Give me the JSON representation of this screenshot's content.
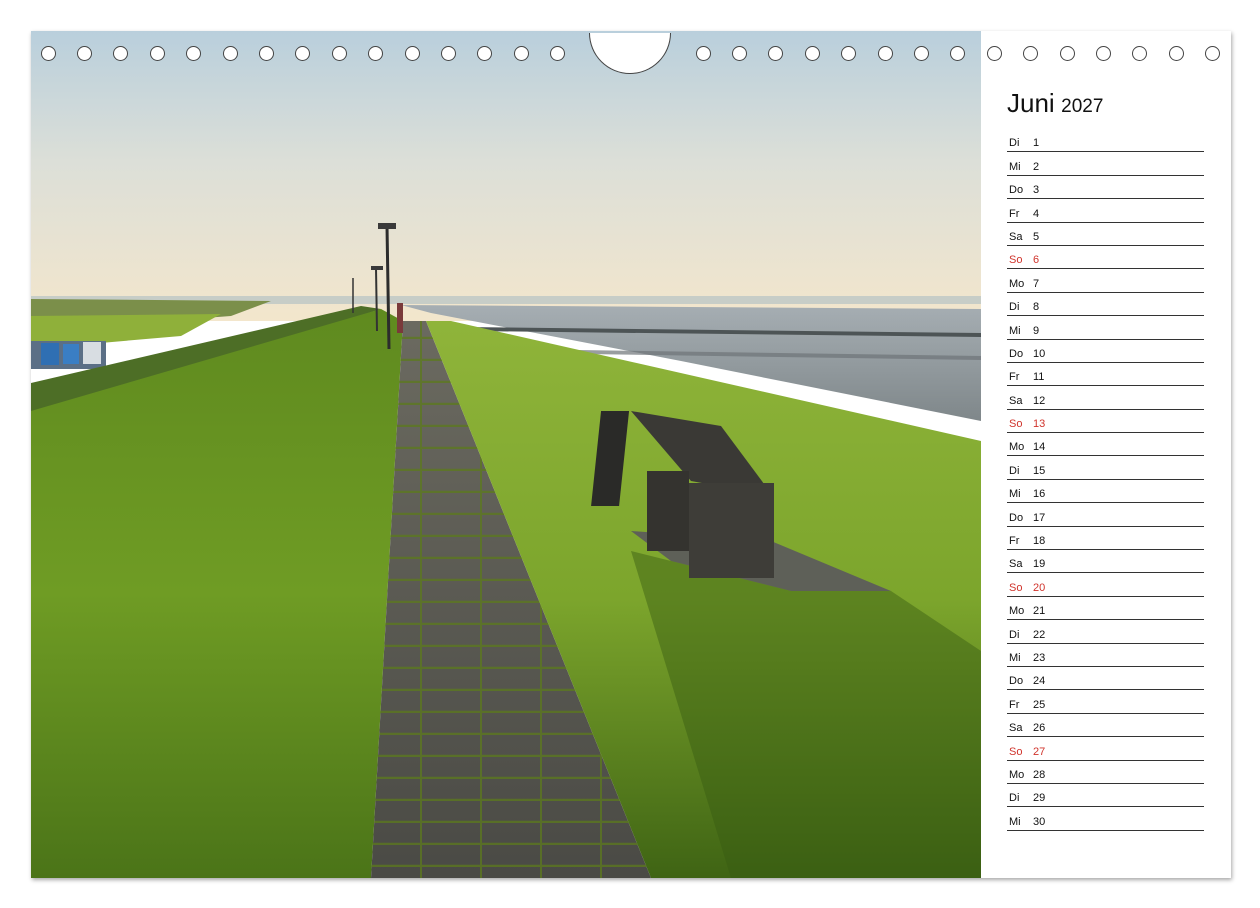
{
  "calendar": {
    "month": "Juni",
    "year": "2027",
    "days": [
      {
        "wd": "Di",
        "num": "1"
      },
      {
        "wd": "Mi",
        "num": "2"
      },
      {
        "wd": "Do",
        "num": "3"
      },
      {
        "wd": "Fr",
        "num": "4"
      },
      {
        "wd": "Sa",
        "num": "5"
      },
      {
        "wd": "So",
        "num": "6"
      },
      {
        "wd": "Mo",
        "num": "7"
      },
      {
        "wd": "Di",
        "num": "8"
      },
      {
        "wd": "Mi",
        "num": "9"
      },
      {
        "wd": "Do",
        "num": "10"
      },
      {
        "wd": "Fr",
        "num": "11"
      },
      {
        "wd": "Sa",
        "num": "12"
      },
      {
        "wd": "So",
        "num": "13"
      },
      {
        "wd": "Mo",
        "num": "14"
      },
      {
        "wd": "Di",
        "num": "15"
      },
      {
        "wd": "Mi",
        "num": "16"
      },
      {
        "wd": "Do",
        "num": "17"
      },
      {
        "wd": "Fr",
        "num": "18"
      },
      {
        "wd": "Sa",
        "num": "19"
      },
      {
        "wd": "So",
        "num": "20"
      },
      {
        "wd": "Mo",
        "num": "21"
      },
      {
        "wd": "Di",
        "num": "22"
      },
      {
        "wd": "Mi",
        "num": "23"
      },
      {
        "wd": "Do",
        "num": "24"
      },
      {
        "wd": "Fr",
        "num": "25"
      },
      {
        "wd": "Sa",
        "num": "26"
      },
      {
        "wd": "So",
        "num": "27"
      },
      {
        "wd": "Mo",
        "num": "28"
      },
      {
        "wd": "Di",
        "num": "29"
      },
      {
        "wd": "Mi",
        "num": "30"
      }
    ]
  },
  "colors": {
    "sunday": "#d0342c",
    "text": "#111111",
    "line": "#333333",
    "grass": "#6f9a22",
    "sky": "#f2e7cf"
  }
}
